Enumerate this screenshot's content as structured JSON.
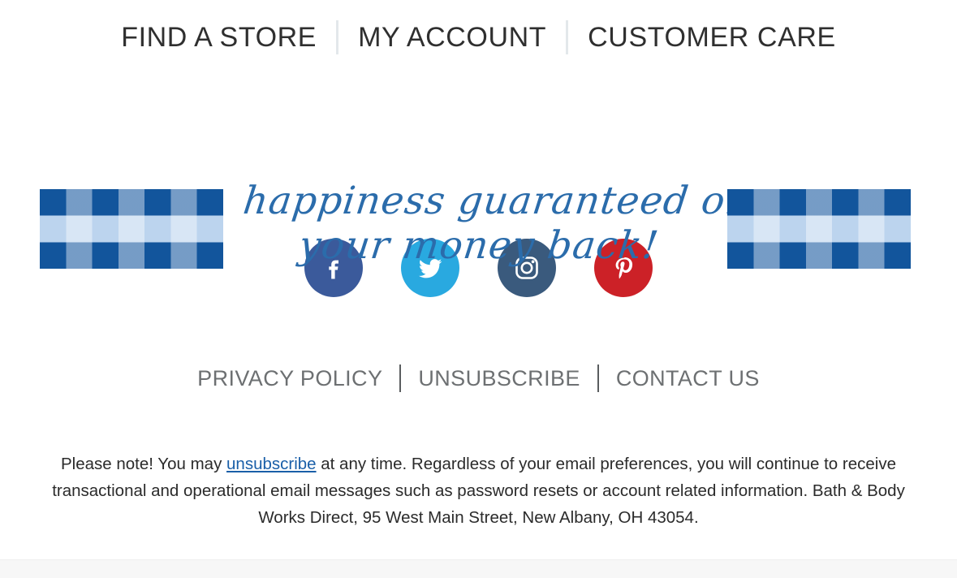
{
  "topnav": {
    "items": [
      {
        "label": "FIND A STORE",
        "name": "find-a-store"
      },
      {
        "label": "MY ACCOUNT",
        "name": "my-account"
      },
      {
        "label": "CUSTOMER CARE",
        "name": "customer-care"
      }
    ],
    "divider_color": "#e3e8eb",
    "text_color": "#2f2f2f"
  },
  "guarantee": {
    "line1": "happiness guaranteed or",
    "line2": "your money back!",
    "script_color": "#2b6cab",
    "gingham": {
      "dark_blue": "#12559c",
      "mid_blue": "#5288c4",
      "light_blue": "#bcd4ee",
      "white": "#ffffff"
    }
  },
  "social": {
    "items": [
      {
        "name": "facebook-icon",
        "label": "Facebook",
        "color": "#3b5a9b"
      },
      {
        "name": "twitter-icon",
        "label": "Twitter",
        "color": "#29a9e0"
      },
      {
        "name": "instagram-icon",
        "label": "Instagram",
        "color": "#3a5a7d"
      },
      {
        "name": "pinterest-icon",
        "label": "Pinterest",
        "color": "#cc2127"
      }
    ]
  },
  "footer_links": {
    "items": [
      {
        "label": "PRIVACY POLICY",
        "name": "privacy-policy"
      },
      {
        "label": "UNSUBSCRIBE",
        "name": "unsubscribe"
      },
      {
        "label": "CONTACT US",
        "name": "contact-us"
      }
    ],
    "text_color": "#6d7072",
    "divider_color": "#5a5d5f"
  },
  "legal": {
    "before_link": "Please note! You may ",
    "link_text": "unsubscribe",
    "after_link": " at any time. Regardless of your email preferences, you will continue to receive transactional and operational email messages such as password resets or account related information. Bath & Body Works Direct, 95 West Main Street, New Albany, OH 43054.",
    "link_color": "#1a5fa8",
    "text_color": "#2b2b2b"
  }
}
